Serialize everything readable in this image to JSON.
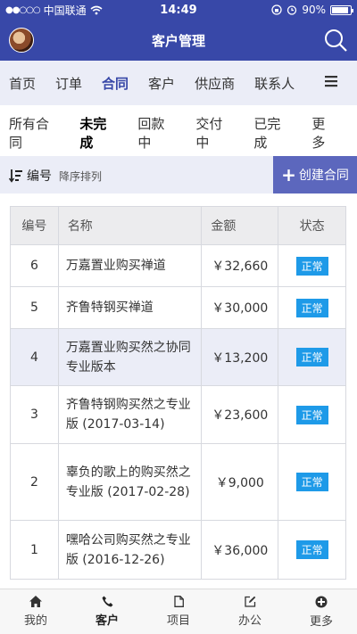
{
  "status_bar": {
    "carrier": "中国联通",
    "time": "14:49",
    "battery": "90%"
  },
  "header": {
    "title": "客户管理"
  },
  "main_nav": {
    "items": [
      "首页",
      "订单",
      "合同",
      "客户",
      "供应商",
      "联系人"
    ],
    "active": "合同"
  },
  "sub_tabs": {
    "items": [
      "所有合同",
      "未完成",
      "回款中",
      "交付中",
      "已完成",
      "更多"
    ],
    "active": "未完成"
  },
  "toolbar": {
    "sort_label": "编号",
    "sort_order": "降序排列",
    "create_label": "创建合同"
  },
  "table": {
    "headers": [
      "编号",
      "名称",
      "金额",
      "状态"
    ],
    "rows": [
      {
        "id": "6",
        "name": "万嘉置业购买禅道",
        "amount": "￥32,660",
        "status": "正常"
      },
      {
        "id": "5",
        "name": "齐鲁特钢买禅道",
        "amount": "￥30,000",
        "status": "正常"
      },
      {
        "id": "4",
        "name": "万嘉置业购买然之协同专业版本",
        "amount": "￥13,200",
        "status": "正常"
      },
      {
        "id": "3",
        "name": "齐鲁特钢购买然之专业版 (2017-03-14)",
        "amount": "￥23,600",
        "status": "正常"
      },
      {
        "id": "2",
        "name": "辜负的歌上的购买然之专业版 (2017-02-28)",
        "amount": "￥9,000",
        "status": "正常"
      },
      {
        "id": "1",
        "name": "嘿哈公司购买然之专业版 (2016-12-26)",
        "amount": "￥36,000",
        "status": "正常"
      }
    ]
  },
  "tab_bar": {
    "items": [
      {
        "label": "我的",
        "icon": "home-icon"
      },
      {
        "label": "客户",
        "icon": "phone-icon"
      },
      {
        "label": "项目",
        "icon": "document-icon"
      },
      {
        "label": "办公",
        "icon": "edit-icon"
      },
      {
        "label": "更多",
        "icon": "plus-circle-icon"
      }
    ],
    "active": "客户"
  },
  "colors": {
    "brand": "#3848a8",
    "nav_bg": "#ebedf7",
    "create_button": "#5c67bd",
    "badge": "#1e9ae8"
  }
}
